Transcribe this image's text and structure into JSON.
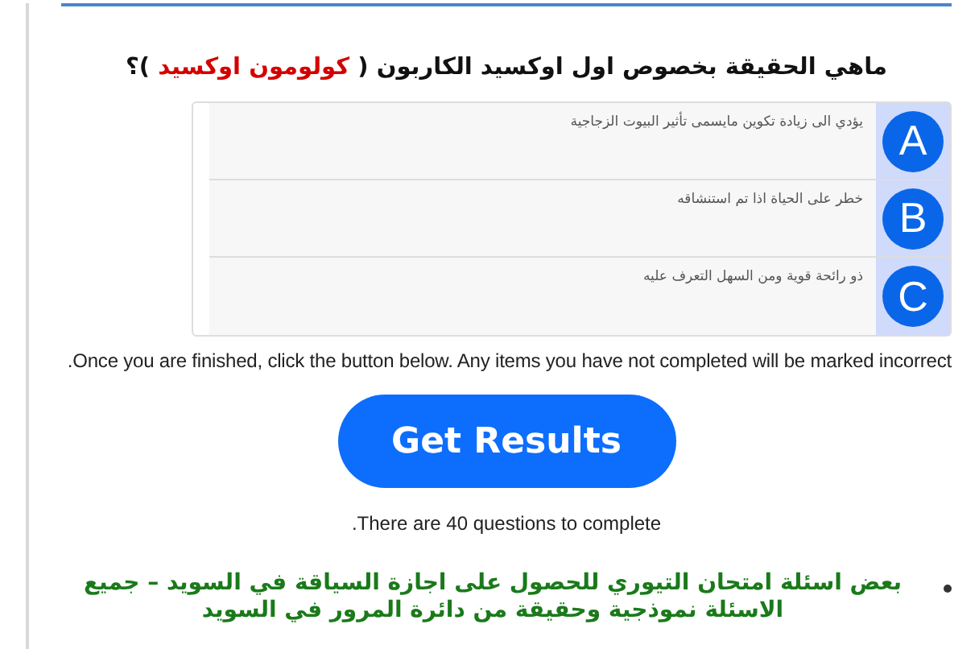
{
  "question": {
    "title_parts": [
      {
        "text": "ماهي الحقيقة بخصوص اول اوكسيد الكاربون ( ",
        "highlighted": false
      },
      {
        "text": "كولومون اوكسيد",
        "highlighted": true
      },
      {
        "text": " )؟",
        "highlighted": false
      }
    ]
  },
  "options": [
    {
      "letter": "A",
      "text": "يؤدي الى زيادة تكوين مايسمى تأثير البيوت الزجاجية"
    },
    {
      "letter": "B",
      "text": "خطر على الحياة اذا تم استنشاقه"
    },
    {
      "letter": "C",
      "text": "ذو رائحة قوية ومن السهل التعرف عليه"
    }
  ],
  "instructions": "Once you are finished, click the button below. Any items you have not completed will be marked incorrect.",
  "submit_button": "Get Results",
  "question_count": "There are 40 questions to complete.",
  "bullets": [
    "بعض اسئلة امتحان التيوري للحصول على اجازة السياقة في السويد – جميع الاسئلة نموذجية وحقيقة من دائرة المرور في السويد"
  ]
}
